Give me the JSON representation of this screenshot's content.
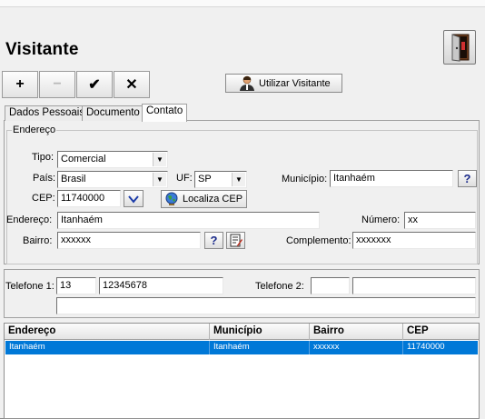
{
  "window": {
    "title": "Visitante"
  },
  "toolbar": {
    "add": "+",
    "remove": "−",
    "confirm": "✔",
    "cancel": "✕",
    "use_visitor": "Utilizar Visitante"
  },
  "tabs": [
    {
      "label": "Dados Pessoais"
    },
    {
      "label": "Documento"
    },
    {
      "label": "Contato"
    }
  ],
  "endereco": {
    "group_title": "Endereço",
    "tipo": {
      "label": "Tipo:",
      "value": "Comercial"
    },
    "pais": {
      "label": "País:",
      "value": "Brasil"
    },
    "uf": {
      "label": "UF:",
      "value": "SP"
    },
    "municipio": {
      "label": "Município:",
      "value": "Itanhaém",
      "help": "?"
    },
    "cep": {
      "label": "CEP:",
      "value": "11740000",
      "locate_label": "Localiza CEP"
    },
    "endereco": {
      "label": "Endereço:",
      "value": "Itanhaém"
    },
    "numero": {
      "label": "Número:",
      "value": "xx"
    },
    "bairro": {
      "label": "Bairro:",
      "value": "xxxxxx",
      "help": "?"
    },
    "complemento": {
      "label": "Complemento:",
      "value": "xxxxxxx"
    }
  },
  "telefones": {
    "tel1": {
      "label": "Telefone 1:",
      "ddd": "13",
      "number": "12345678"
    },
    "tel2": {
      "label": "Telefone 2:",
      "ddd": "",
      "number": ""
    },
    "extra": ""
  },
  "grid": {
    "columns": [
      "Endereço",
      "Município",
      "Bairro",
      "CEP"
    ],
    "rows": [
      [
        "Itanhaém",
        "Itanhaém",
        "xxxxxx",
        "11740000"
      ]
    ]
  },
  "colors": {
    "selection": "#0078d7",
    "help_text": "#1a2a8a"
  }
}
